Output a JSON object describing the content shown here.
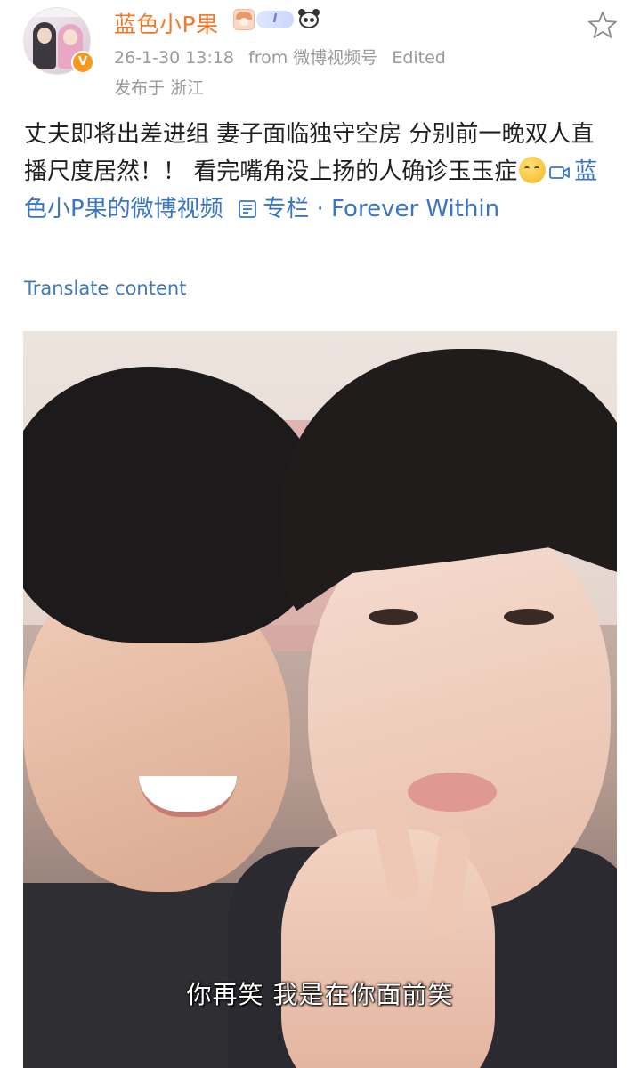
{
  "post": {
    "username": "蓝色小P果",
    "badge_label": "I",
    "timestamp": "26-1-30 13:18",
    "source": "from 微博视频号",
    "edited": "Edited",
    "location": "发布于 浙江",
    "text": "丈夫即将出差进组 妻子面临独守空房 分别前一晚双人直播尺度居然！！ 看完嘴角没上扬的人确诊玉玉症",
    "video_link": "蓝色小P果的微博视频",
    "column_link": "专栏 · Forever Within",
    "translate": "Translate content"
  },
  "video": {
    "subtitle": "你再笑 我是在你面前笑"
  },
  "icons": {
    "verified": "V",
    "star": "star-icon",
    "emoji": "drooling-face",
    "video_link_icon": "video-camera-icon",
    "column_link_icon": "column-icon"
  },
  "colors": {
    "username": "#f2792a",
    "link": "#3a75c4",
    "meta": "#9a9a9a",
    "verified": "#f59a1f"
  }
}
